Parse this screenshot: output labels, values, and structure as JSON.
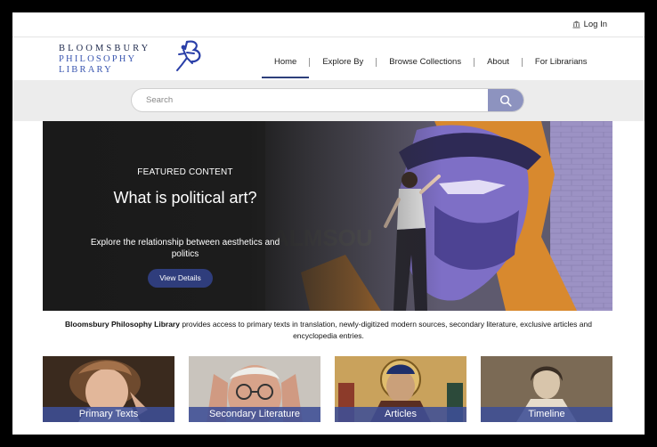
{
  "header": {
    "login_label": "Log In",
    "logo": {
      "line1": "BLOOMSBURY",
      "line2": "PHILOSOPHY",
      "line3": "LIBRARY"
    },
    "nav": [
      {
        "label": "Home",
        "active": true
      },
      {
        "label": "Explore By",
        "active": false
      },
      {
        "label": "Browse Collections",
        "active": false
      },
      {
        "label": "About",
        "active": false
      },
      {
        "label": "For Librarians",
        "active": false
      }
    ]
  },
  "search": {
    "placeholder": "Search",
    "icon": "search-icon"
  },
  "hero": {
    "eyebrow": "FEATURED CONTENT",
    "title": "What is political art?",
    "subtitle": "Explore the relationship between aesthetics and politics",
    "button_label": "View Details"
  },
  "intro": {
    "brand": "Bloomsbury Philosophy Library",
    "text": " provides access to primary texts in translation, newly-digitized modern sources, secondary literature, exclusive articles and encyclopedia entries."
  },
  "cards": [
    {
      "label": "Primary Texts"
    },
    {
      "label": "Secondary Literature"
    },
    {
      "label": "Articles"
    },
    {
      "label": "Timeline"
    }
  ],
  "colors": {
    "brand_navy": "#2f3d7c",
    "search_button": "#8d93bf",
    "card_label_bg": "#3e4e96",
    "logo_blue": "#3a56b0"
  }
}
